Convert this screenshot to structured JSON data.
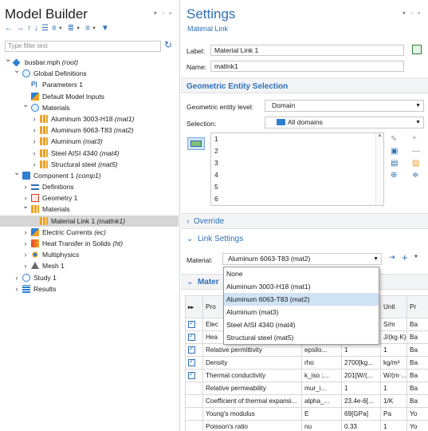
{
  "model_builder": {
    "title": "Model Builder",
    "filter_placeholder": "Type filter text",
    "tree": [
      {
        "label": "busbar.mph",
        "tag": "(root)",
        "indent": 0,
        "chev": "v",
        "icon": "root"
      },
      {
        "label": "Global Definitions",
        "tag": "",
        "indent": 1,
        "chev": "v",
        "icon": "globe"
      },
      {
        "label": "Parameters 1",
        "tag": "",
        "indent": 2,
        "chev": "",
        "icon": "param"
      },
      {
        "label": "Default Model Inputs",
        "tag": "",
        "indent": 2,
        "chev": "",
        "icon": "dmi"
      },
      {
        "label": "Materials",
        "tag": "",
        "indent": 2,
        "chev": "v",
        "icon": "mat-globe"
      },
      {
        "label": "Aluminum 3003-H18",
        "tag": "(mat1)",
        "indent": 3,
        "chev": ">",
        "icon": "mat"
      },
      {
        "label": "Aluminum 6063-T83",
        "tag": "(mat2)",
        "indent": 3,
        "chev": ">",
        "icon": "mat"
      },
      {
        "label": "Aluminum",
        "tag": "(mat3)",
        "indent": 3,
        "chev": ">",
        "icon": "mat"
      },
      {
        "label": "Steel AISI 4340",
        "tag": "(mat4)",
        "indent": 3,
        "chev": ">",
        "icon": "mat"
      },
      {
        "label": "Structural steel",
        "tag": "(mat5)",
        "indent": 3,
        "chev": ">",
        "icon": "mat"
      },
      {
        "label": "Component 1",
        "tag": "(comp1)",
        "indent": 1,
        "chev": "v",
        "icon": "comp"
      },
      {
        "label": "Definitions",
        "tag": "",
        "indent": 2,
        "chev": ">",
        "icon": "defs"
      },
      {
        "label": "Geometry 1",
        "tag": "",
        "indent": 2,
        "chev": ">",
        "icon": "geom"
      },
      {
        "label": "Materials",
        "tag": "",
        "indent": 2,
        "chev": "v",
        "icon": "mat"
      },
      {
        "label": "Material Link 1",
        "tag": "(matlnk1)",
        "indent": 3,
        "chev": "",
        "icon": "mat",
        "selected": true
      },
      {
        "label": "Electric Currents",
        "tag": "(ec)",
        "indent": 2,
        "chev": ">",
        "icon": "ec"
      },
      {
        "label": "Heat Transfer in Solids",
        "tag": "(ht)",
        "indent": 2,
        "chev": ">",
        "icon": "ht"
      },
      {
        "label": "Multiphysics",
        "tag": "",
        "indent": 2,
        "chev": ">",
        "icon": "multi"
      },
      {
        "label": "Mesh 1",
        "tag": "",
        "indent": 2,
        "chev": ">",
        "icon": "mesh"
      },
      {
        "label": "Study 1",
        "tag": "",
        "indent": 1,
        "chev": ">",
        "icon": "study"
      },
      {
        "label": "Results",
        "tag": "",
        "indent": 1,
        "chev": ">",
        "icon": "results"
      }
    ]
  },
  "settings": {
    "title": "Settings",
    "subtitle": "Material Link",
    "label_caption": "Label:",
    "label_value": "Material Link 1",
    "name_caption": "Name:",
    "name_value": "matlnk1",
    "geo_section": "Geometric Entity Selection",
    "geo_level_caption": "Geometric entity level:",
    "geo_level_value": "Domain",
    "selection_caption": "Selection:",
    "selection_value": "All domains",
    "domains": [
      "1",
      "2",
      "3",
      "4",
      "5",
      "6"
    ],
    "override_section": "Override",
    "link_section": "Link Settings",
    "material_caption": "Material:",
    "material_value": "Aluminum 6063-T83 (mat2)",
    "material_options": [
      "None",
      "Aluminum 3003-H18 (mat1)",
      "Aluminum 6063-T83 (mat2)",
      "Aluminum (mat3)",
      "Steel AISI 4340 (mat4)",
      "Structural steel (mat5)"
    ],
    "highlighted_option": 2,
    "mat_props_section": "Mater",
    "table_headers": [
      "Pro",
      "",
      "",
      "Unit",
      "Pr"
    ],
    "table_rows": [
      {
        "checked": true,
        "property": "Elec",
        "var": "",
        "value": "",
        "unit": "S/m",
        "src": "Ba"
      },
      {
        "checked": true,
        "property": "Hea",
        "var": "",
        "value": "",
        "unit": "J/(kg·K)",
        "src": "Ba"
      },
      {
        "checked": true,
        "property": "Relative permittivity",
        "var": "epsilo...",
        "value": "1",
        "unit": "1",
        "src": "Ba"
      },
      {
        "checked": true,
        "property": "Density",
        "var": "rho",
        "value": "2700[kg...",
        "unit": "kg/m³",
        "src": "Ba"
      },
      {
        "checked": true,
        "property": "Thermal conductivity",
        "var": "k_iso ;...",
        "value": "201[W/(...",
        "unit": "W/(m·...",
        "src": "Ba"
      },
      {
        "checked": false,
        "property": "Relative permeability",
        "var": "mur_i...",
        "value": "1",
        "unit": "1",
        "src": "Ba"
      },
      {
        "checked": false,
        "property": "Coefficient of thermal expansi...",
        "var": "alpha_...",
        "value": "23.4e-6[...",
        "unit": "1/K",
        "src": "Ba"
      },
      {
        "checked": false,
        "property": "Young's modulus",
        "var": "E",
        "value": "69[GPa]",
        "unit": "Pa",
        "src": "Yo"
      },
      {
        "checked": false,
        "property": "Poisson's ratio",
        "var": "nu",
        "value": "0.33",
        "unit": "1",
        "src": "Yo"
      }
    ]
  },
  "colors": {
    "accent": "#2e6fb5",
    "selection": "#d6d6d6",
    "highlight": "#cfe3f5"
  }
}
